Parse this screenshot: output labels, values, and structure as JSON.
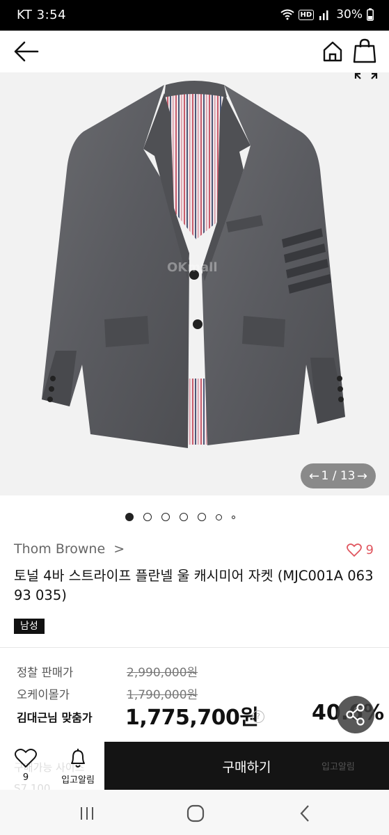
{
  "status_bar": {
    "carrier_time": "KT 3:54",
    "hd": "HD",
    "battery": "30%"
  },
  "header": {
    "back_icon": "arrow-left-icon",
    "home_icon": "home-icon",
    "bag_icon": "shopping-bag-icon"
  },
  "gallery": {
    "watermark": "OKmall",
    "counter": "1 / 13",
    "dots_total": 7,
    "active_dot": 0
  },
  "product": {
    "brand": "Thom Browne",
    "brand_chevron": ">",
    "like_count": "9",
    "title": "토널 4바 스트라이프 플란넬 울 캐시미어 자켓 (MJC001A 06393 035)",
    "gender_badge": "남성"
  },
  "pricing": {
    "retail_label": "정찰 판매가",
    "retail_price": "2,990,000원",
    "okmall_label": "오케이몰가",
    "okmall_price": "1,790,000원",
    "member_label": "김대근님 맞춤가",
    "member_price": "1,775,700원",
    "info_icon": "?",
    "discount": "40.6%"
  },
  "bottom_bar": {
    "ghost_line1": "구매가능 사이즈",
    "ghost_line2": "S7  100",
    "wish_count": "9",
    "alert_label": "입고알림",
    "buy_label": "구매하기",
    "buy_ghost": "입고알림"
  },
  "colors": {
    "heart": "#e0565f",
    "buy_button": "#141414",
    "counter_pill": "#8a8a8a",
    "image_bg": "#f2f2f2"
  }
}
